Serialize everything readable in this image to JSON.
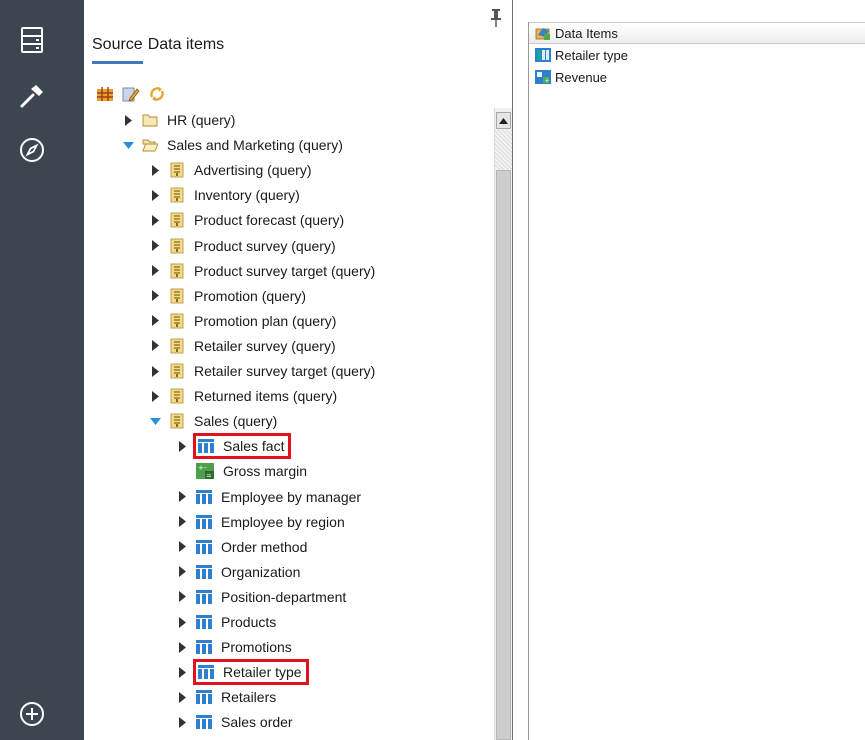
{
  "source_panel": {
    "tabs": [
      {
        "label": "Source",
        "active": true
      },
      {
        "label": "Data items",
        "active": false
      }
    ],
    "tree": [
      {
        "label": "HR (query)",
        "icon": "folder-icon",
        "expanded": false
      },
      {
        "label": "Sales and Marketing (query)",
        "icon": "folder-open-icon",
        "expanded": true
      },
      {
        "label": "Advertising (query)",
        "icon": "query-subject-icon",
        "expanded": false
      },
      {
        "label": "Inventory (query)",
        "icon": "query-subject-icon",
        "expanded": false
      },
      {
        "label": "Product forecast (query)",
        "icon": "query-subject-icon",
        "expanded": false
      },
      {
        "label": "Product survey (query)",
        "icon": "query-subject-icon",
        "expanded": false
      },
      {
        "label": "Product survey target (query)",
        "icon": "query-subject-icon",
        "expanded": false
      },
      {
        "label": "Promotion (query)",
        "icon": "query-subject-icon",
        "expanded": false
      },
      {
        "label": "Promotion plan (query)",
        "icon": "query-subject-icon",
        "expanded": false
      },
      {
        "label": "Retailer survey (query)",
        "icon": "query-subject-icon",
        "expanded": false
      },
      {
        "label": "Retailer survey target (query)",
        "icon": "query-subject-icon",
        "expanded": false
      },
      {
        "label": "Returned items (query)",
        "icon": "query-subject-icon",
        "expanded": false
      },
      {
        "label": "Sales (query)",
        "icon": "query-subject-icon",
        "expanded": true
      },
      {
        "label": "Sales fact",
        "icon": "table-icon",
        "expanded": false,
        "highlighted": true
      },
      {
        "label": "Gross margin",
        "icon": "calculation-icon",
        "expanded": null
      },
      {
        "label": "Employee by manager",
        "icon": "table-icon",
        "expanded": false
      },
      {
        "label": "Employee by region",
        "icon": "table-icon",
        "expanded": false
      },
      {
        "label": "Order method",
        "icon": "table-icon",
        "expanded": false
      },
      {
        "label": "Organization",
        "icon": "table-icon",
        "expanded": false
      },
      {
        "label": "Position-department",
        "icon": "table-icon",
        "expanded": false
      },
      {
        "label": "Products",
        "icon": "table-icon",
        "expanded": false
      },
      {
        "label": "Promotions",
        "icon": "table-icon",
        "expanded": false
      },
      {
        "label": "Retailer type",
        "icon": "table-icon",
        "expanded": false,
        "highlighted": true
      },
      {
        "label": "Retailers",
        "icon": "table-icon",
        "expanded": false
      },
      {
        "label": "Sales order",
        "icon": "table-icon",
        "expanded": false
      }
    ]
  },
  "data_panel": {
    "header": "Data Items",
    "items": [
      {
        "label": "Retailer type",
        "icon": "attribute-icon"
      },
      {
        "label": "Revenue",
        "icon": "measure-icon"
      }
    ]
  },
  "colors": {
    "rail": "#3c4651",
    "tab_underline": "#4178be",
    "highlight": "#e0121c",
    "table_icon": "#2f7fd1"
  }
}
